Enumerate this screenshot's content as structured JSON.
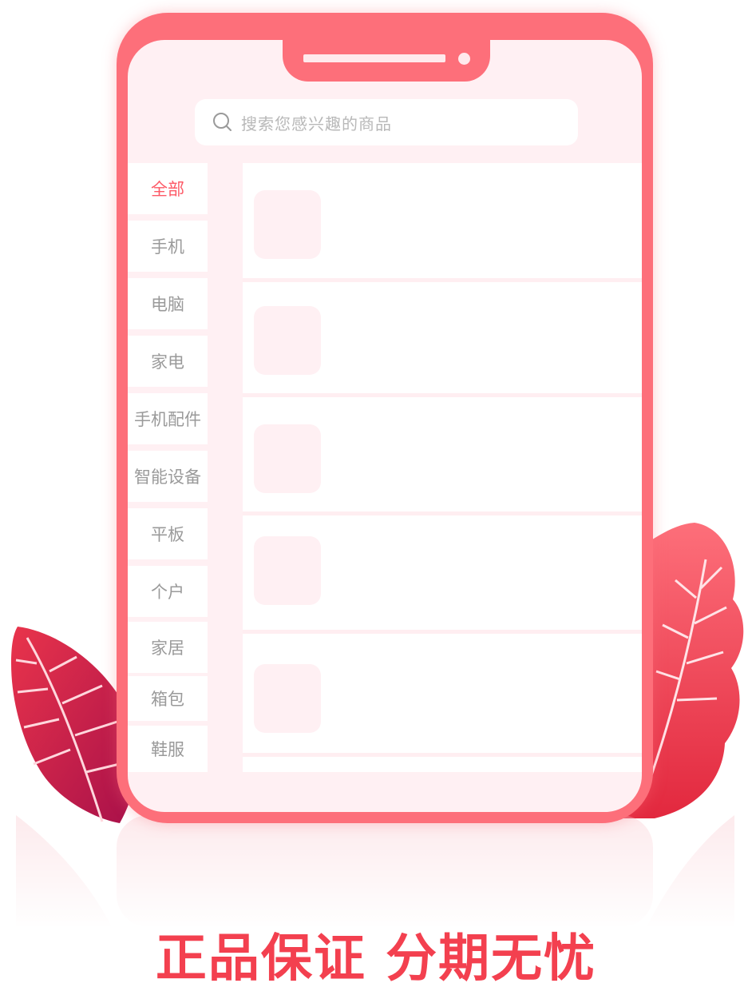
{
  "search": {
    "placeholder": "搜索您感兴趣的商品",
    "icon": "search-icon"
  },
  "sidebar": {
    "items": [
      {
        "label": "全部",
        "active": true
      },
      {
        "label": "手机",
        "active": false
      },
      {
        "label": "电脑",
        "active": false
      },
      {
        "label": "家电",
        "active": false
      },
      {
        "label": "手机配件",
        "active": false
      },
      {
        "label": "智能设备",
        "active": false
      },
      {
        "label": "平板",
        "active": false
      },
      {
        "label": "个户",
        "active": false
      },
      {
        "label": "家居",
        "active": false
      },
      {
        "label": "箱包",
        "active": false
      },
      {
        "label": "鞋服",
        "active": false
      }
    ]
  },
  "products": [
    {
      "placeholder": true
    },
    {
      "placeholder": true
    },
    {
      "placeholder": true
    },
    {
      "placeholder": true
    },
    {
      "placeholder": true
    }
  ],
  "slogan": "正品保证 分期无忧",
  "colors": {
    "accent": "#fd6f7a",
    "active_text": "#fd5a67",
    "slogan": "#f3404f",
    "screen_bg": "#fff0f3"
  }
}
